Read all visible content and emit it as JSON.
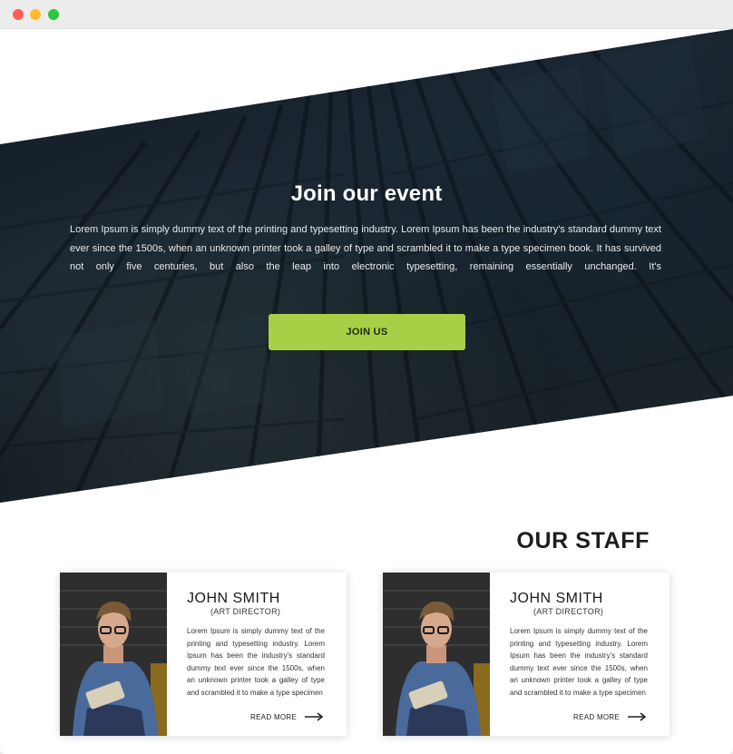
{
  "hero": {
    "title": "Join our event",
    "body": "Lorem Ipsum is simply dummy text of the printing and typesetting industry. Lorem Ipsum has been the industry's standard dummy text ever since the 1500s, when an unknown printer took a galley of type and scrambled it to make a type specimen book. It has survived not only five centuries, but also the leap into electronic typesetting, remaining essentially unchanged. It's",
    "button_label": "JOIN US",
    "button_color": "#a8cf45"
  },
  "staff": {
    "title": "OUR STAFF",
    "members": [
      {
        "name": "JOHN SMITH",
        "role": "(ART DIRECTOR)",
        "bio": "Lorem Ipsum is simply dummy text of the printing and typesetting industry. Lorem Ipsum has been the industry's standard dummy text ever since the 1500s, when an unknown printer took a galley of type and scrambled it to make a type specimen",
        "link_label": "READ MORE",
        "link_icon": "arrow-right-icon"
      },
      {
        "name": "JOHN SMITH",
        "role": "(ART DIRECTOR)",
        "bio": "Lorem Ipsum is simply dummy text of the printing and typesetting industry. Lorem Ipsum has been the industry's standard dummy text ever since the 1500s, when an unknown printer took a galley of type and scrambled it to make a type specimen",
        "link_label": "READ MORE",
        "link_icon": "arrow-right-icon"
      }
    ]
  }
}
